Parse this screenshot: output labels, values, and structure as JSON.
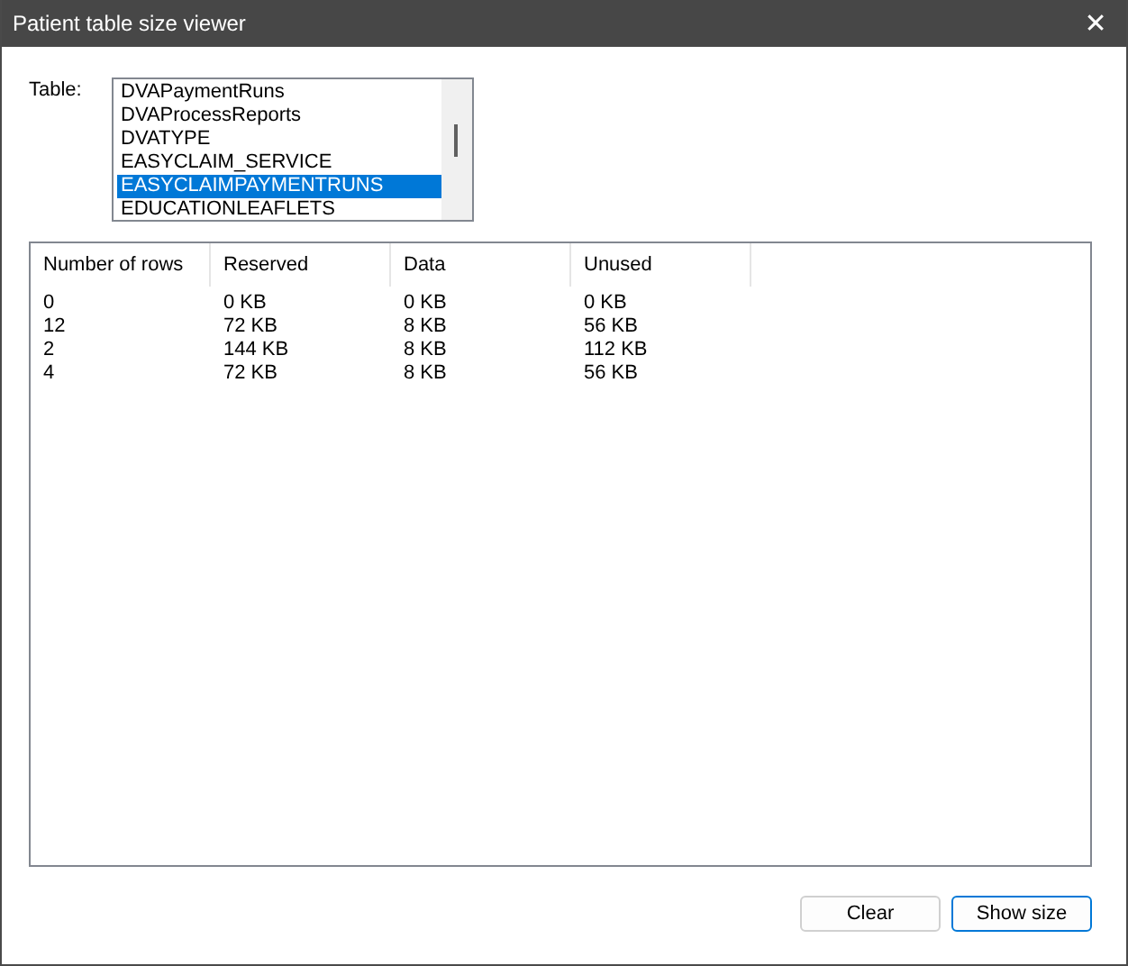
{
  "window": {
    "title": "Patient table size viewer",
    "close": "✕"
  },
  "table_picker": {
    "label": "Table:",
    "items": [
      {
        "text": "DVAPaymentRuns",
        "selected": false
      },
      {
        "text": "DVAProcessReports",
        "selected": false
      },
      {
        "text": "DVATYPE",
        "selected": false
      },
      {
        "text": "EASYCLAIM_SERVICE",
        "selected": false
      },
      {
        "text": "EASYCLAIMPAYMENTRUNS",
        "selected": true
      },
      {
        "text": "EDUCATIONLEAFLETS",
        "selected": false
      }
    ]
  },
  "table": {
    "columns": [
      "Number of rows",
      "Reserved",
      "Data",
      "Unused"
    ],
    "rows": [
      [
        "0",
        "0 KB",
        "0 KB",
        "0 KB"
      ],
      [
        "12",
        "72 KB",
        "8 KB",
        "56 KB"
      ],
      [
        "2",
        "144 KB",
        "8 KB",
        "112 KB"
      ],
      [
        "4",
        "72 KB",
        "8 KB",
        "56 KB"
      ]
    ]
  },
  "buttons": [
    {
      "label": "Clear",
      "default": false
    },
    {
      "label": "Show size",
      "default": true
    }
  ]
}
